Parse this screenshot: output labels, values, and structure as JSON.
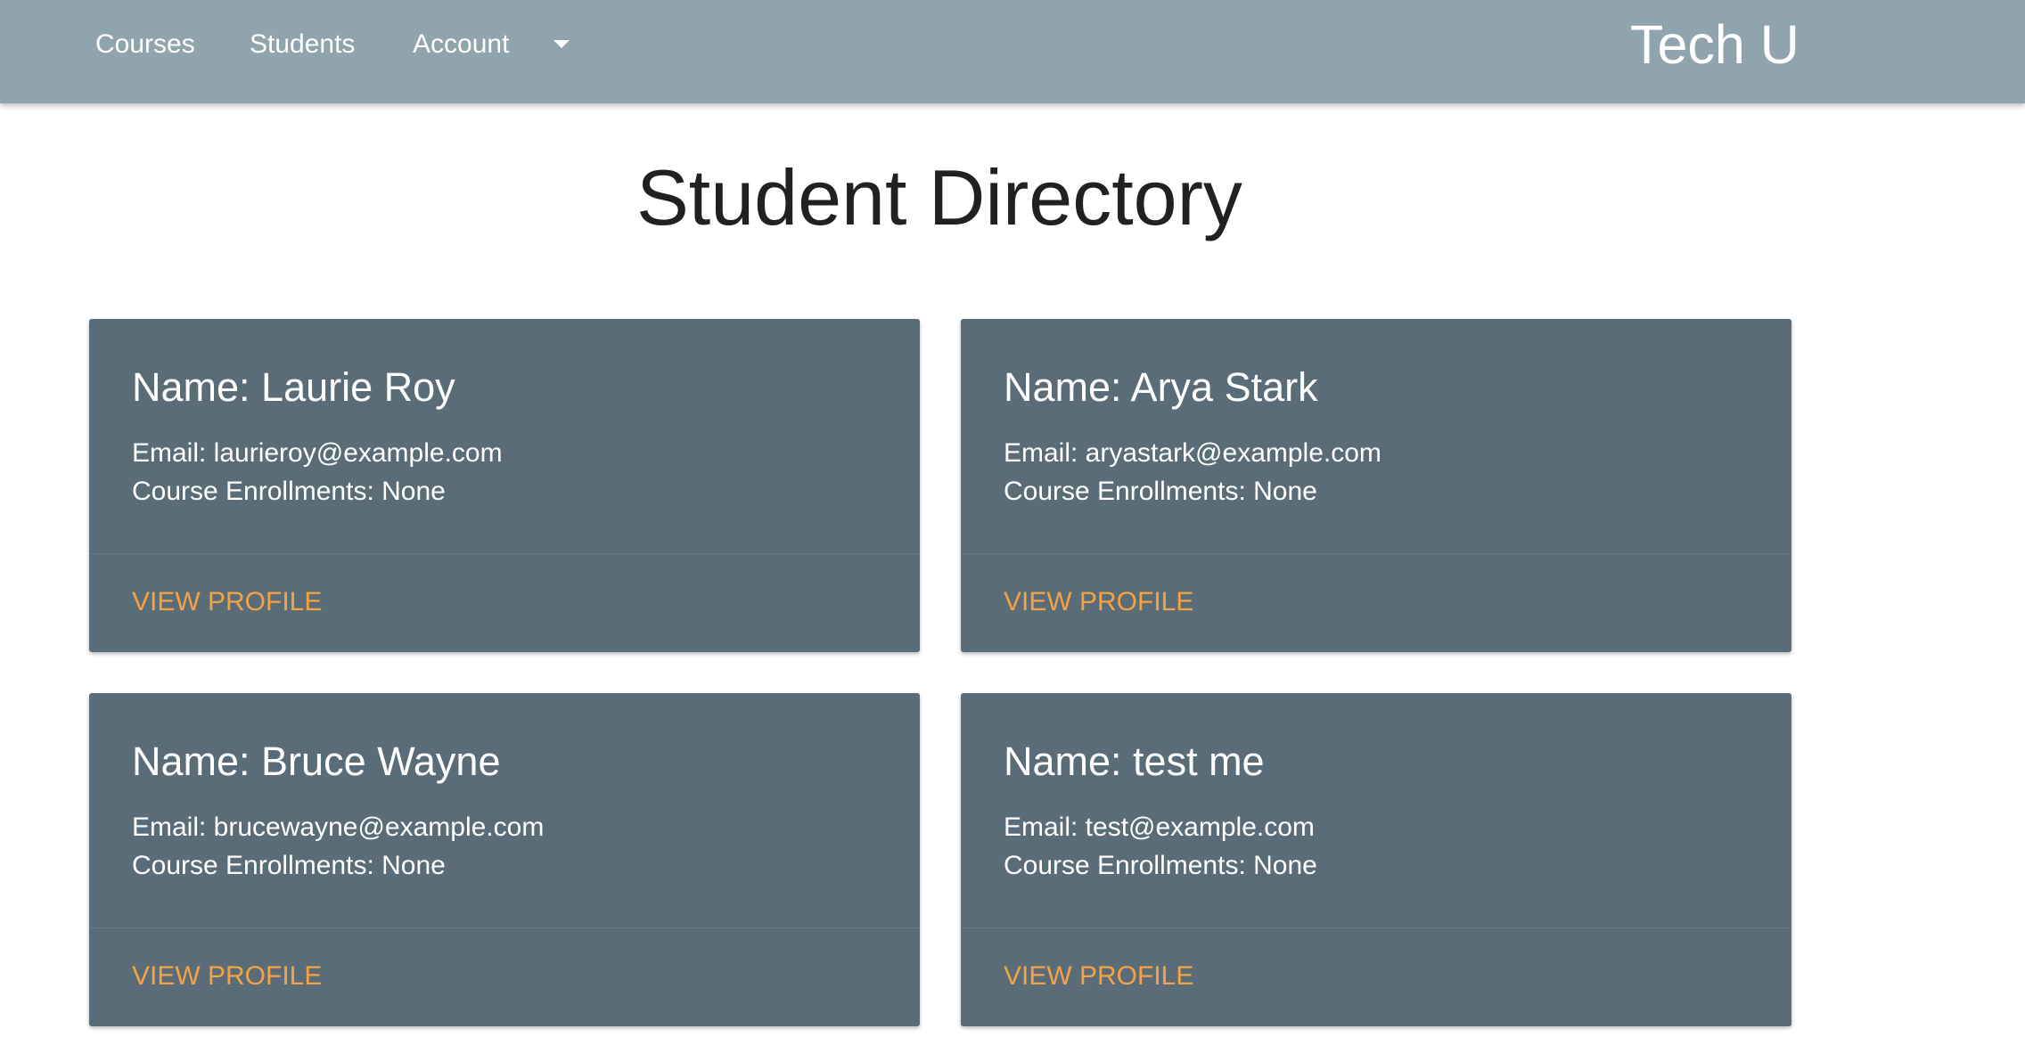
{
  "nav": {
    "courses": "Courses",
    "students": "Students",
    "account": "Account",
    "brand": "Tech U",
    "bar_color": "#90a4ae"
  },
  "page": {
    "title": "Student Directory"
  },
  "students": [
    {
      "name": "Name: Laurie Roy",
      "email": "Email: laurieroy@example.com",
      "enrollments": "Course Enrollments: None",
      "action": "VIEW PROFILE"
    },
    {
      "name": "Name: Arya Stark",
      "email": "Email: aryastark@example.com",
      "enrollments": "Course Enrollments: None",
      "action": "VIEW PROFILE"
    },
    {
      "name": "Name: Bruce Wayne",
      "email": "Email: brucewayne@example.com",
      "enrollments": "Course Enrollments: None",
      "action": "VIEW PROFILE"
    },
    {
      "name": "Name: test me",
      "email": "Email: test@example.com",
      "enrollments": "Course Enrollments: None",
      "action": "VIEW PROFILE"
    }
  ],
  "colors": {
    "card_background": "#5a6c78",
    "action_accent": "#f5a342"
  }
}
